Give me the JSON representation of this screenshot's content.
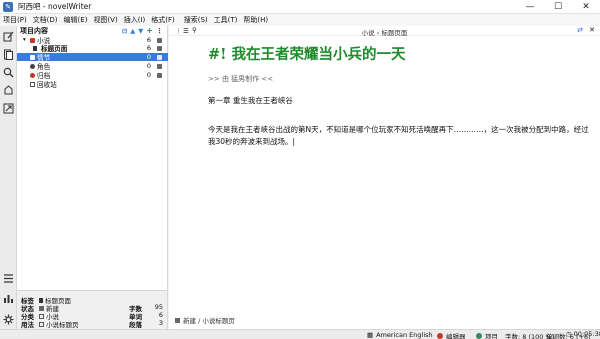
{
  "window": {
    "title": "阿西吧 - novelWriter"
  },
  "menu": [
    "项目(P)",
    "文档(D)",
    "编辑(E)",
    "视图(V)",
    "插入(I)",
    "格式(F)",
    "搜索(S)",
    "工具(T)",
    "帮助(H)"
  ],
  "tree": {
    "header": "项目内容",
    "rows": [
      {
        "label": "小说",
        "count": "6"
      },
      {
        "label": "标题页面",
        "count": "6"
      },
      {
        "label": "情节",
        "count": "0"
      },
      {
        "label": "角色",
        "count": "0"
      },
      {
        "label": "归档",
        "count": "0"
      },
      {
        "label": "回收站",
        "count": ""
      }
    ]
  },
  "details": {
    "label_key": "标签",
    "label_val": "标题页面",
    "status_key": "状态",
    "status_val": "新建",
    "class_key": "分类",
    "class_val": "小说",
    "usage_key": "用法",
    "usage_val": "小说标题页",
    "chars_key": "字数",
    "chars_val": "95",
    "words_key": "单词",
    "words_val": "6",
    "paras_key": "段落",
    "paras_val": "3"
  },
  "editor": {
    "title": "小说 › 标题页面",
    "doc_title": "#! 我在王者荣耀当小兵的一天",
    "doc_meta": ">> 由 猛男制作 <<",
    "doc_heading": "第一章 重生我在王者峡谷",
    "doc_paragraph": "今天是我在王者峡谷出战的第N天，不知道是哪个位玩家不知死活唤醒再下…………，这一次我被分配到中路，经过我30秒的奔波来到战场。|",
    "footer": "新建 / 小说标题页"
  },
  "status": {
    "language": "American English",
    "editor_label": "编辑器",
    "project_label": "项目",
    "words": "字数: 8 (100 %)",
    "word_count": "单词数: 6 (+6)",
    "time": "00:05:38"
  },
  "colors": {
    "title_green": "#1f8a2a",
    "selection": "#3a7bd5",
    "status_red": "#c0392b",
    "status_green": "#2e8b57"
  }
}
